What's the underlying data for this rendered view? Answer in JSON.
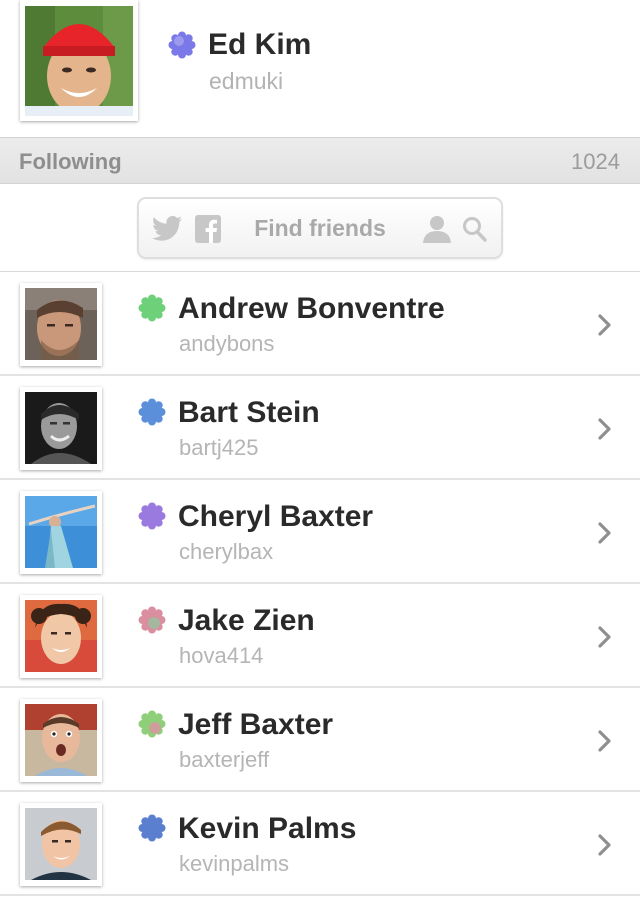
{
  "profile": {
    "name": "Ed Kim",
    "handle": "edmuki",
    "badge_color": "#7b78e8"
  },
  "section": {
    "title": "Following",
    "count": "1024"
  },
  "find_friends": {
    "label": "Find friends",
    "icons": [
      "twitter-icon",
      "facebook-icon",
      "person-icon",
      "search-icon"
    ]
  },
  "following": [
    {
      "name": "Andrew Bonventre",
      "handle": "andybons",
      "badge_color": "#6fd07a"
    },
    {
      "name": "Bart Stein",
      "handle": "bartj425",
      "badge_color": "#5b8fd9"
    },
    {
      "name": "Cheryl Baxter",
      "handle": "cherylbax",
      "badge_color": "#9b7ae0"
    },
    {
      "name": "Jake Zien",
      "handle": "hova414",
      "badge_color": "#d98f9f"
    },
    {
      "name": "Jeff Baxter",
      "handle": "baxterjeff",
      "badge_color": "#8fcf7a"
    },
    {
      "name": "Kevin Palms",
      "handle": "kevinpalms",
      "badge_color": "#5b7fcf"
    }
  ]
}
